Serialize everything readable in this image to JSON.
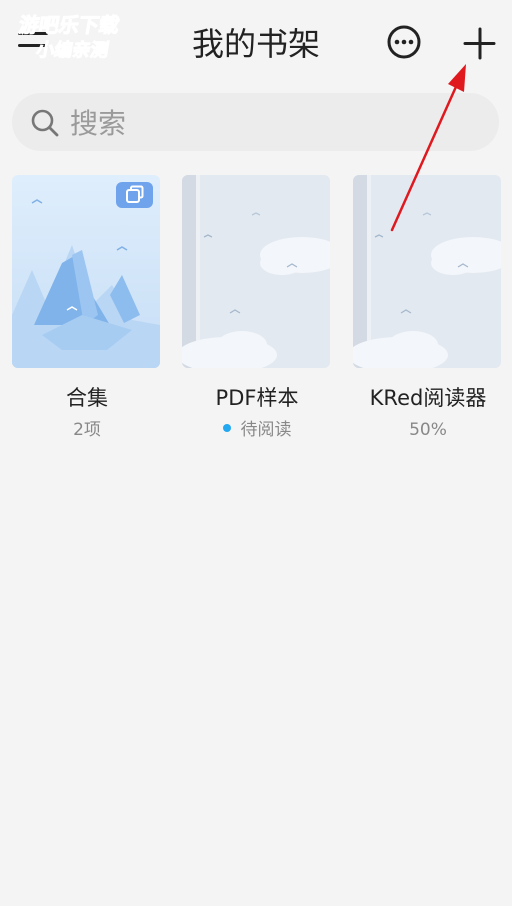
{
  "header": {
    "title": "我的书架",
    "menu_icon": "hamburger-menu-icon",
    "more_icon": "more-circle-icon",
    "add_icon": "plus-icon"
  },
  "watermark": {
    "line1": "游吧乐下载",
    "line2": "小编亲测"
  },
  "search": {
    "placeholder": "搜索",
    "value": ""
  },
  "books": [
    {
      "title": "合集",
      "subtitle": "2项"
    },
    {
      "title": "PDF样本",
      "subtitle": "待阅读"
    },
    {
      "title": "KRed阅读器",
      "subtitle": "50%"
    }
  ],
  "colors": {
    "accent_dot": "#22a8f0",
    "annotation_arrow": "#e0191f",
    "cover_light": "#e3eaf3",
    "collection_cover": "#cfe3f7"
  }
}
